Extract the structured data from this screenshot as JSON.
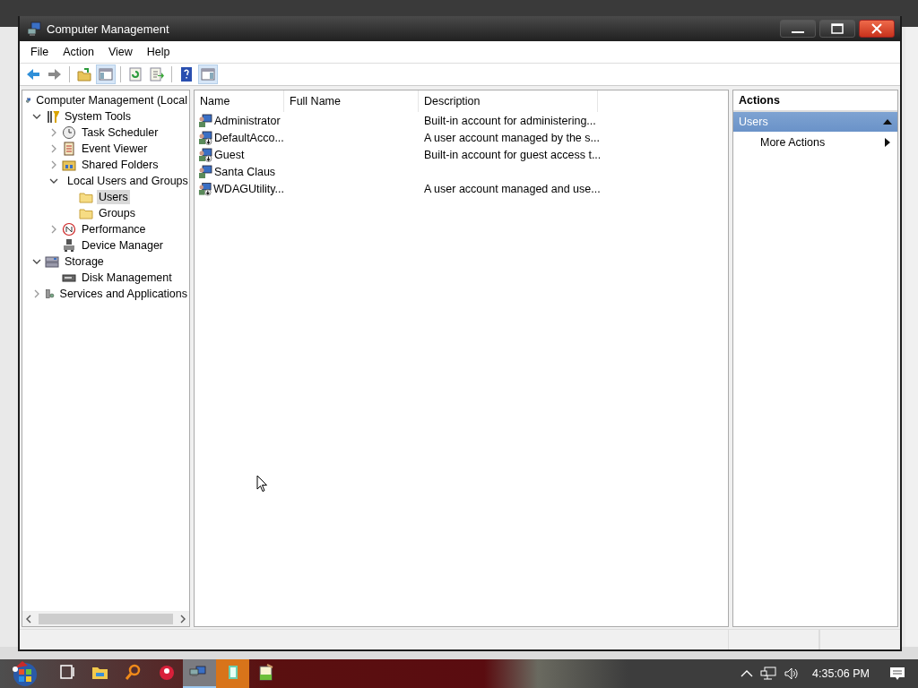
{
  "window": {
    "title": "Computer Management"
  },
  "menu": [
    "File",
    "Action",
    "View",
    "Help"
  ],
  "toolbar": [
    {
      "kind": "back",
      "pressed": false
    },
    {
      "kind": "forward",
      "pressed": false
    },
    {
      "kind": "sep"
    },
    {
      "kind": "up",
      "pressed": false
    },
    {
      "kind": "tree",
      "pressed": true
    },
    {
      "kind": "sep"
    },
    {
      "kind": "refresh",
      "pressed": false
    },
    {
      "kind": "export",
      "pressed": false
    },
    {
      "kind": "sep"
    },
    {
      "kind": "help",
      "pressed": false
    },
    {
      "kind": "pane",
      "pressed": true
    }
  ],
  "tree": [
    {
      "label": "Computer Management (Local",
      "kind": "computer",
      "selected": false,
      "children": [
        {
          "label": "System Tools",
          "kind": "tools",
          "expanded": true,
          "selected": false,
          "children": [
            {
              "label": "Task Scheduler",
              "kind": "clock",
              "expanded": false,
              "selected": false
            },
            {
              "label": "Event Viewer",
              "kind": "log",
              "expanded": false,
              "selected": false
            },
            {
              "label": "Shared Folders",
              "kind": "share",
              "expanded": false,
              "selected": false
            },
            {
              "label": "Local Users and Groups",
              "kind": "users",
              "expanded": true,
              "selected": false,
              "children": [
                {
                  "label": "Users",
                  "kind": "folder",
                  "selected": true
                },
                {
                  "label": "Groups",
                  "kind": "folder",
                  "selected": false
                }
              ]
            },
            {
              "label": "Performance",
              "kind": "perf",
              "expanded": false,
              "selected": false
            },
            {
              "label": "Device Manager",
              "kind": "device",
              "selected": false
            }
          ]
        },
        {
          "label": "Storage",
          "kind": "storage",
          "expanded": true,
          "selected": false,
          "children": [
            {
              "label": "Disk Management",
              "kind": "disk",
              "selected": false
            }
          ]
        },
        {
          "label": "Services and Applications",
          "kind": "services",
          "expanded": false,
          "selected": false
        }
      ]
    }
  ],
  "list": {
    "columns": [
      "Name",
      "Full Name",
      "Description"
    ],
    "rows": [
      {
        "name": "Administrator",
        "description": "Built-in account for administering...",
        "disabled": false
      },
      {
        "name": "DefaultAcco...",
        "description": "A user account managed by the s...",
        "disabled": true
      },
      {
        "name": "Guest",
        "description": "Built-in account for guest access t...",
        "disabled": true
      },
      {
        "name": "Santa Claus",
        "disabled": false
      },
      {
        "name": "WDAGUtility...",
        "description": "A user account managed and use...",
        "disabled": true
      }
    ]
  },
  "actions": {
    "title": "Actions",
    "section": "Users",
    "items": [
      "More Actions"
    ]
  },
  "taskbar": {
    "apps": [
      {
        "kind": "taskview",
        "active": false
      },
      {
        "kind": "explorer",
        "active": false
      },
      {
        "kind": "search",
        "active": false
      },
      {
        "kind": "red",
        "active": false
      },
      {
        "kind": "mmc",
        "active": true
      },
      {
        "kind": "green",
        "active": false
      },
      {
        "kind": "notepad",
        "active": false
      }
    ],
    "clock": "4:35:06 PM"
  }
}
